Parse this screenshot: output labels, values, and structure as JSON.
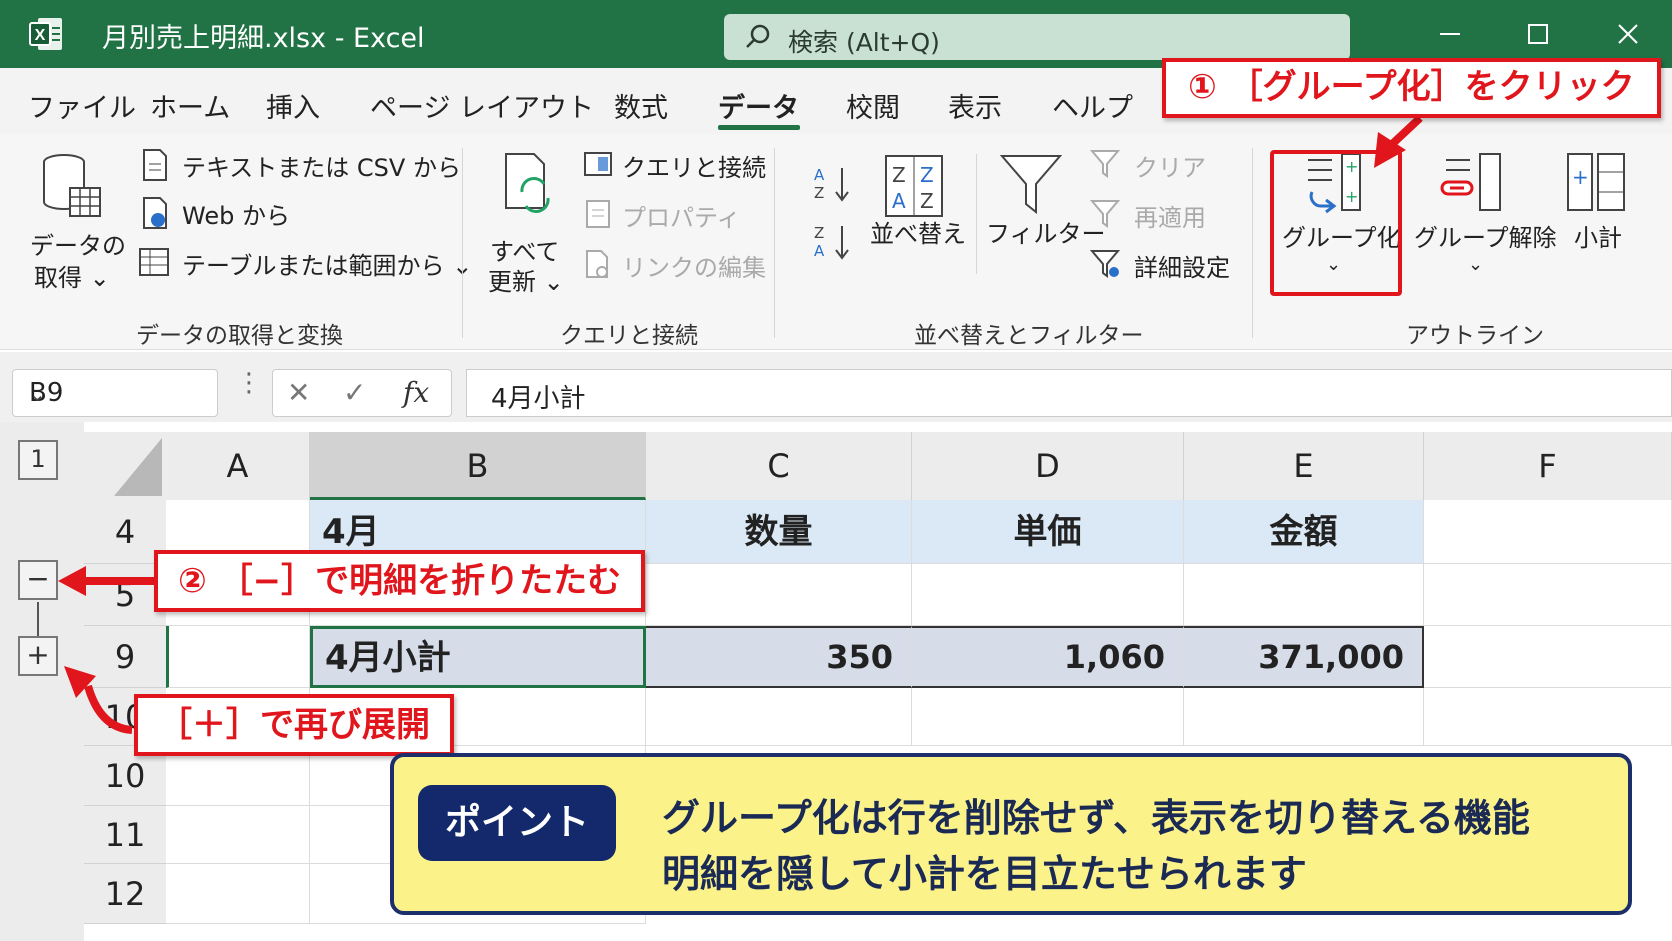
{
  "window": {
    "title": "月別売上明細.xlsx  -  Excel",
    "search_placeholder": "検索 (Alt+Q)"
  },
  "tabs": [
    "ファイル",
    "ホーム",
    "挿入",
    "ページ レイアウト",
    "数式",
    "データ",
    "校閲",
    "表示",
    "ヘルプ"
  ],
  "active_tab": "データ",
  "ribbon": {
    "get_data": {
      "big_button_line1": "データの",
      "big_button_line2": "取得 ⌄",
      "text_csv": "テキストまたは CSV から",
      "web": "Web から",
      "table_range": "テーブルまたは範囲から ⌄",
      "group_label": "データの取得と変換"
    },
    "queries": {
      "refresh_line1": "すべて",
      "refresh_line2": "更新 ⌄",
      "queries_connections": "クエリと接続",
      "properties": "プロパティ",
      "edit_links": "リンクの編集",
      "group_label": "クエリと接続"
    },
    "sort_filter": {
      "sort": "並べ替え",
      "filter": "フィルター",
      "clear": "クリア",
      "reapply": "再適用",
      "advanced": "詳細設定",
      "group_label": "並べ替えとフィルター"
    },
    "outline": {
      "group": "グループ化",
      "ungroup": "グループ解除",
      "subtotal": "小計",
      "group_label": "アウトライン"
    }
  },
  "formula_bar": {
    "name_box": "B9",
    "formula": "4月小計"
  },
  "sheet": {
    "outline_level": "1",
    "columns": [
      "A",
      "B",
      "C",
      "D",
      "E",
      "F"
    ],
    "rows": [
      {
        "num": "4",
        "b": "4月",
        "c": "数量",
        "d": "単価",
        "e": "金額"
      },
      {
        "num": "5",
        "b": "",
        "c": "",
        "d": "",
        "e": ""
      },
      {
        "num": "9",
        "b": "4月小計",
        "c": "350",
        "d": "1,060",
        "e": "371,000"
      },
      {
        "num": "10",
        "b": "",
        "c": "",
        "d": "",
        "e": ""
      },
      {
        "num": "10",
        "b": "",
        "c": "",
        "d": "",
        "e": ""
      },
      {
        "num": "11",
        "b": "",
        "c": "",
        "d": "",
        "e": ""
      },
      {
        "num": "12",
        "b": "",
        "c": "",
        "d": "",
        "e": ""
      }
    ],
    "collapse_symbol": "−",
    "expand_symbol": "+"
  },
  "annotations": {
    "step1": "① ［グループ化］をクリック",
    "step2": "② ［−］で明細を折りたたむ",
    "step3": "［＋］で再び展開",
    "point_tag": "ポイント",
    "point_line1": "グループ化は行を削除せず、表示を切り替える機能",
    "point_line2": "明細を隠して小計を目立たせられます"
  },
  "colors": {
    "excel_green": "#217346",
    "callout_red": "#e0161c",
    "point_navy": "#13296b",
    "point_yellow": "#fbf38a"
  }
}
